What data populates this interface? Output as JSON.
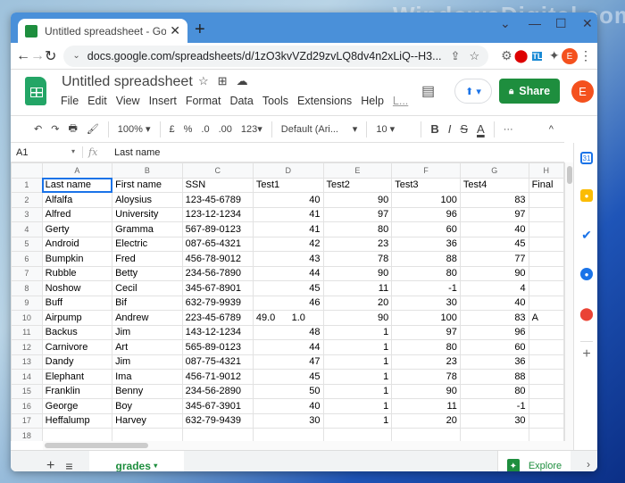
{
  "watermark": "WindowsDigital.com",
  "browser": {
    "tab_title": "Untitled spreadsheet - Google Sh",
    "url": "docs.google.com/spreadsheets/d/1zO3kvVZd29zvLQ8dv4n2xLiQ--H3...",
    "profile_initial": "E",
    "window_controls": [
      "⌄",
      "—",
      "☐",
      "✕"
    ]
  },
  "sheets": {
    "doc_title": "Untitled spreadsheet",
    "menu": [
      "File",
      "Edit",
      "View",
      "Insert",
      "Format",
      "Data",
      "Tools",
      "Extensions",
      "Help",
      "L..."
    ],
    "share_label": "Share",
    "profile_initial": "E",
    "toolbar": {
      "zoom": "100%",
      "currency": "£",
      "percent": "%",
      "dec_decrease": ".0",
      "dec_increase": ".00",
      "number_format": "123",
      "font": "Default (Ari...",
      "font_size": "10",
      "bold": "B",
      "italic": "I",
      "strike": "S",
      "text_color": "A",
      "more": "···",
      "collapse": "^"
    },
    "formula_bar": {
      "cell_ref": "A1",
      "fx": "fx",
      "value": "Last name"
    },
    "columns": [
      "A",
      "B",
      "C",
      "D",
      "E",
      "F",
      "G",
      "H"
    ],
    "rows": [
      [
        "Last name",
        "First name",
        "SSN",
        "Test1",
        "Test2",
        "Test3",
        "Test4",
        "Final"
      ],
      [
        "Alfalfa",
        "Aloysius",
        "123-45-6789",
        "40",
        "90",
        "100",
        "83",
        ""
      ],
      [
        "Alfred",
        "University",
        "123-12-1234",
        "41",
        "97",
        "96",
        "97",
        ""
      ],
      [
        "Gerty",
        "Gramma",
        "567-89-0123",
        "41",
        "80",
        "60",
        "40",
        ""
      ],
      [
        "Android",
        "Electric",
        "087-65-4321",
        "42",
        "23",
        "36",
        "45",
        ""
      ],
      [
        "Bumpkin",
        "Fred",
        "456-78-9012",
        "43",
        "78",
        "88",
        "77",
        ""
      ],
      [
        "Rubble",
        "Betty",
        "234-56-7890",
        "44",
        "90",
        "80",
        "90",
        ""
      ],
      [
        "Noshow",
        "Cecil",
        "345-67-8901",
        "45",
        "11",
        "-1",
        "4",
        ""
      ],
      [
        "Buff",
        "Bif",
        "632-79-9939",
        "46",
        "20",
        "30",
        "40",
        ""
      ],
      [
        "Airpump",
        "Andrew",
        "223-45-6789",
        "49.0      1.0",
        "90",
        "100",
        "83",
        "A"
      ],
      [
        "Backus",
        "Jim",
        "143-12-1234",
        "48",
        "1",
        "97",
        "96",
        ""
      ],
      [
        "Carnivore",
        "Art",
        "565-89-0123",
        "44",
        "1",
        "80",
        "60",
        ""
      ],
      [
        "Dandy",
        "Jim",
        "087-75-4321",
        "47",
        "1",
        "23",
        "36",
        ""
      ],
      [
        "Elephant",
        "Ima",
        "456-71-9012",
        "45",
        "1",
        "78",
        "88",
        ""
      ],
      [
        "Franklin",
        "Benny",
        "234-56-2890",
        "50",
        "1",
        "90",
        "80",
        ""
      ],
      [
        "George",
        "Boy",
        "345-67-3901",
        "40",
        "1",
        "11",
        "-1",
        ""
      ],
      [
        "Heffalump",
        "Harvey",
        "632-79-9439",
        "30",
        "1",
        "20",
        "30",
        ""
      ],
      [
        "",
        "",
        "",
        "",
        "",
        "",
        "",
        ""
      ]
    ],
    "sheet_tab": "grades",
    "explore_label": "Explore"
  }
}
